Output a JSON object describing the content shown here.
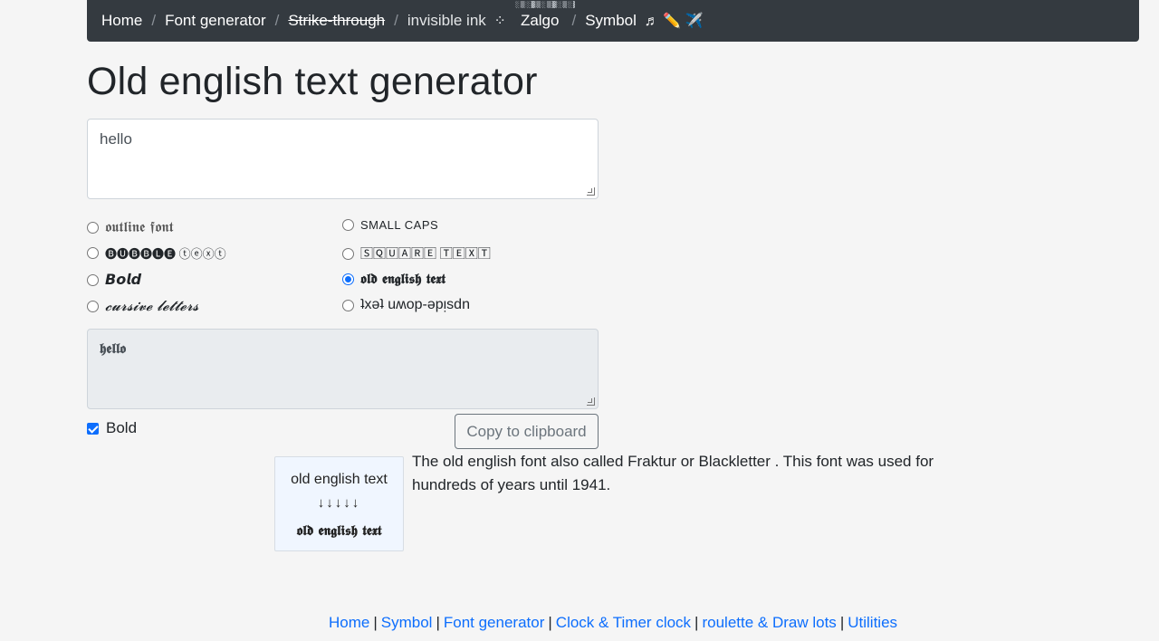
{
  "nav": {
    "home": "Home",
    "font_generator": "Font generator",
    "strike_through": "Strike-through",
    "invisible_ink": "invisible ink",
    "invisible_ink_icon": "sparkle",
    "zalgo": "Zalgo",
    "symbol": "Symbol",
    "symbol_icons": "♬ ✏️ ✈️"
  },
  "page": {
    "title": "Old english text generator"
  },
  "input": {
    "value": "hello"
  },
  "options": [
    {
      "label": "𝖔𝖚𝖙𝖑𝖎𝖓𝖊 𝖋𝖔𝖓𝖙",
      "checked": false
    },
    {
      "label": "SMALL CAPS",
      "checked": false
    },
    {
      "label": "🅑🅤🅑🅑🅛🅔 ⓣⓔⓧⓣ",
      "checked": false
    },
    {
      "label": "🅂🅀🅄🄰🅁🄴 🅃🄴🅇🅃",
      "checked": false
    },
    {
      "label": "𝘽𝙤𝙡𝙙",
      "checked": false
    },
    {
      "label": "𝖔𝖑𝖉 𝖊𝖓𝖌𝖑𝖎𝖘𝖍 𝖙𝖊𝖝𝖙",
      "checked": true
    },
    {
      "label": "𝓬𝓾𝓻𝓼𝓲𝓿𝓮 𝓵𝓮𝓽𝓽𝓮𝓻𝓼",
      "checked": false
    },
    {
      "label": "ʇxǝʇ uʍop-ǝpᴉsdn",
      "checked": false
    }
  ],
  "output": {
    "value": "𝖍𝖊𝖑𝖑𝖔"
  },
  "bold_checkbox": {
    "label": "Bold",
    "checked": true
  },
  "copy_button": "Copy to clipboard",
  "example_card": {
    "plain": "old english text",
    "arrows": "↓↓↓↓↓",
    "fancy": "𝖔𝖑𝖉 𝖊𝖓𝖌𝖑𝖎𝖘𝖍 𝖙𝖊𝖝𝖙"
  },
  "description": "The old english font also called Fraktur or Blackletter . This font was used for hundreds of years until 1941.",
  "footer": {
    "links": [
      "Home",
      "Symbol",
      "Font generator",
      "Clock & Timer clock",
      "roulette & Draw lots",
      "Utilities"
    ]
  },
  "colors": {
    "navbar_bg": "#343a40",
    "accent": "#0d6efd",
    "page_bg": "#f5f5f5"
  }
}
